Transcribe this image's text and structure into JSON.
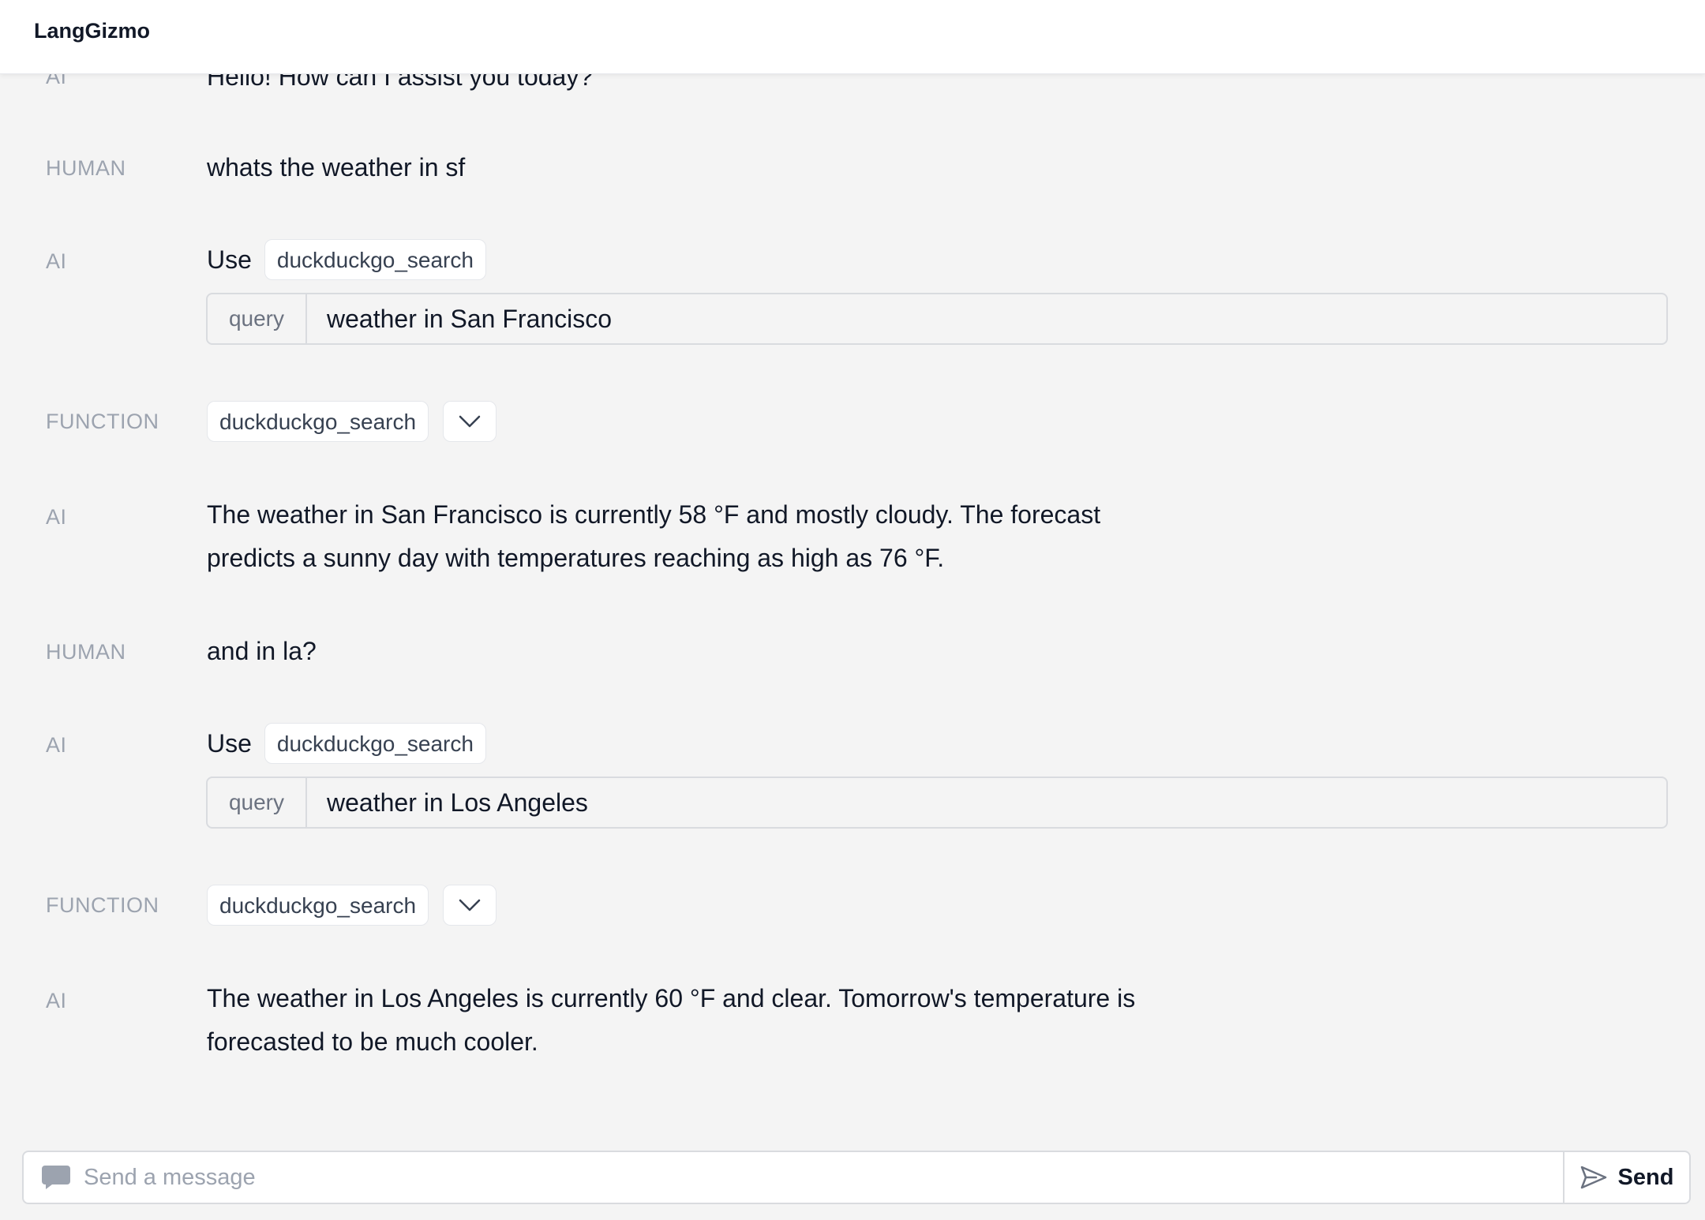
{
  "header": {
    "title": "LangGizmo"
  },
  "messages": [
    {
      "role": "AI",
      "text": "Hello! How can I assist you today?"
    },
    {
      "role": "HUMAN",
      "text": "whats the weather in sf"
    },
    {
      "role": "AI",
      "use_label": "Use",
      "tool": "duckduckgo_search",
      "arg_key": "query",
      "arg_value": "weather in San Francisco"
    },
    {
      "role": "FUNCTION",
      "tool": "duckduckgo_search"
    },
    {
      "role": "AI",
      "line1": "The weather in San Francisco is currently 58 °F and mostly cloudy. The forecast",
      "line2": "predicts a sunny day with temperatures reaching as high as 76 °F."
    },
    {
      "role": "HUMAN",
      "text": "and in la?"
    },
    {
      "role": "AI",
      "use_label": "Use",
      "tool": "duckduckgo_search",
      "arg_key": "query",
      "arg_value": "weather in Los Angeles"
    },
    {
      "role": "FUNCTION",
      "tool": "duckduckgo_search"
    },
    {
      "role": "AI",
      "line1": "The weather in Los Angeles is currently 60 °F and clear. Tomorrow's temperature is",
      "line2": "forecasted to be much cooler."
    }
  ],
  "composer": {
    "placeholder": "Send a message",
    "send_label": "Send"
  },
  "icons": {
    "chat": "chat-bubble-icon",
    "send": "send-icon",
    "expand": "chevron-down-icon"
  }
}
